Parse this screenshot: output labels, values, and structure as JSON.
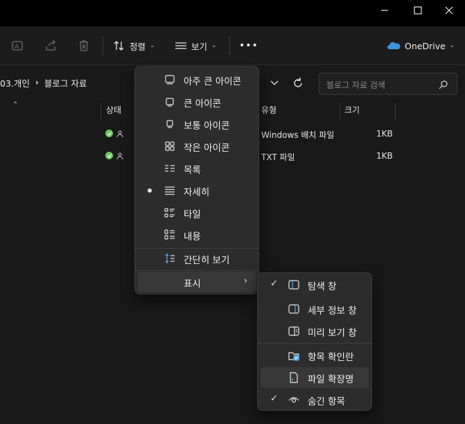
{
  "titlebar": {
    "minimize_icon": "minimize-icon",
    "maximize_icon": "maximize-icon",
    "close_icon": "close-icon"
  },
  "toolbar": {
    "sort_label": "정렬",
    "view_label": "보기",
    "more_label": "•••",
    "onedrive_label": "OneDrive"
  },
  "address": {
    "crumbs": [
      "03.개인",
      "블로그 자료"
    ],
    "search_placeholder": "블로그 자료 검색"
  },
  "columns": {
    "status": "상태",
    "type": "유형",
    "size": "크기"
  },
  "files": [
    {
      "type": "Windows 배치 파일",
      "size": "1KB"
    },
    {
      "type": "TXT 파일",
      "size": "1KB"
    }
  ],
  "view_menu": {
    "items": [
      {
        "label": "아주 큰 아이콘",
        "icon": "extra-large-icons-icon"
      },
      {
        "label": "큰 아이콘",
        "icon": "large-icons-icon"
      },
      {
        "label": "보통 아이콘",
        "icon": "medium-icons-icon"
      },
      {
        "label": "작은 아이콘",
        "icon": "small-icons-icon"
      },
      {
        "label": "목록",
        "icon": "list-icon"
      },
      {
        "label": "자세히",
        "icon": "details-icon",
        "selected": true
      },
      {
        "label": "타일",
        "icon": "tiles-icon"
      },
      {
        "label": "내용",
        "icon": "content-icon"
      },
      {
        "label": "간단히 보기",
        "icon": "compact-view-icon"
      },
      {
        "label": "표시",
        "icon": "",
        "submenu": true
      }
    ]
  },
  "show_menu": {
    "items": [
      {
        "label": "탐색 창",
        "icon": "navigation-pane-icon",
        "checked": true
      },
      {
        "label": "세부 정보 창",
        "icon": "details-pane-icon",
        "checked": false
      },
      {
        "label": "미리 보기 창",
        "icon": "preview-pane-icon",
        "checked": false
      },
      {
        "label": "항목 확인란",
        "icon": "item-checkboxes-icon",
        "checked": false
      },
      {
        "label": "파일 확장명",
        "icon": "file-extensions-icon",
        "checked": false
      },
      {
        "label": "숨긴 항목",
        "icon": "hidden-items-icon",
        "checked": true
      }
    ]
  },
  "colors": {
    "background": "#191919",
    "menu_bg": "#2c2c2c",
    "status_ok": "#6ccb5f",
    "onedrive_blue": "#3a96dd"
  }
}
